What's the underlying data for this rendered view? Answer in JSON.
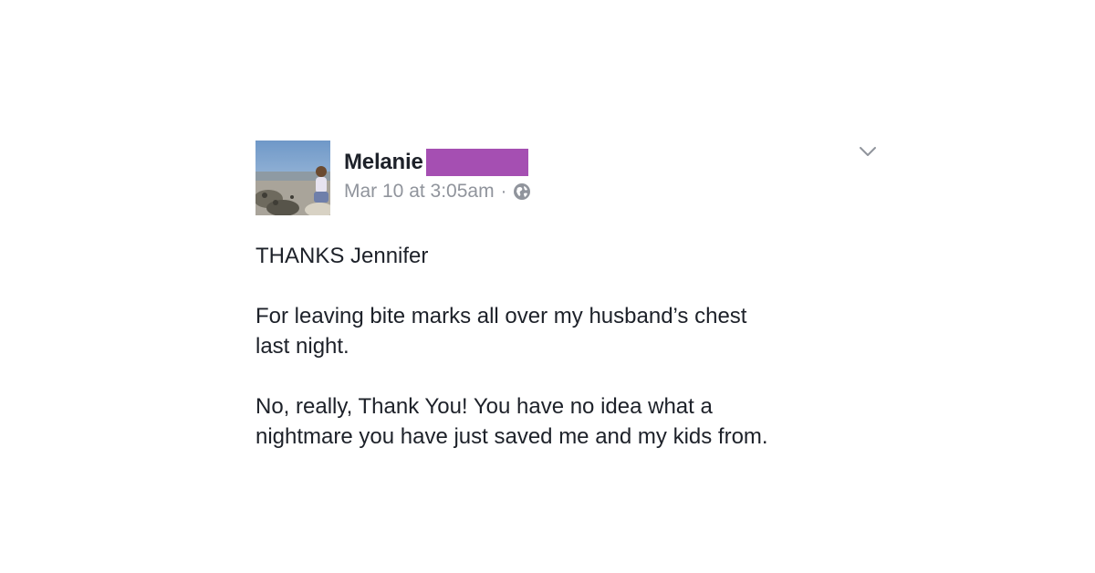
{
  "post": {
    "author_first_name": "Melanie",
    "timestamp": "Mar 10 at 3:05am",
    "separator": "·",
    "privacy_icon": "globe-icon",
    "options_icon": "chevron-down-icon",
    "redaction_color": "#a54fb2",
    "paragraphs": [
      "THANKS Jennifer",
      "For leaving bite marks all over my husband’s chest\nlast night.",
      "No, really, Thank You! You have no idea what a\nnightmare you have just saved me and my kids from."
    ]
  }
}
